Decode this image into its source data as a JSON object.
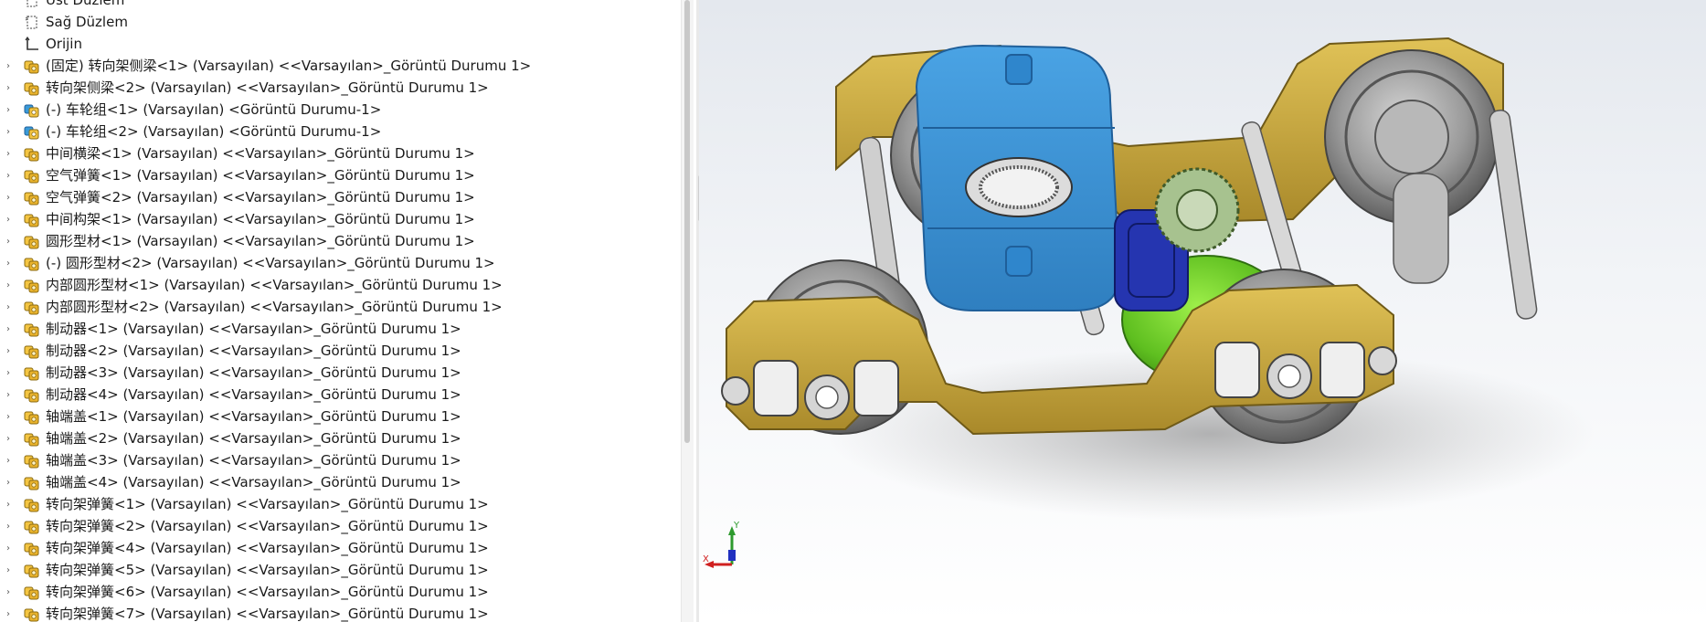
{
  "feature_tree": {
    "rows": [
      {
        "expander": "",
        "icon": "plane-icon",
        "label": "Üst Düzlem"
      },
      {
        "expander": "",
        "icon": "plane-icon",
        "label": "Sağ Düzlem"
      },
      {
        "expander": "",
        "icon": "origin-icon",
        "label": "Orijin"
      },
      {
        "expander": "›",
        "icon": "subassembly-icon",
        "label": "(固定) 转向架侧梁<1> (Varsayılan) <<Varsayılan>_Görüntü Durumu 1>"
      },
      {
        "expander": "›",
        "icon": "subassembly-icon",
        "label": "转向架侧梁<2> (Varsayılan) <<Varsayılan>_Görüntü Durumu 1>"
      },
      {
        "expander": "›",
        "icon": "assembly-icon",
        "label": "(-) 车轮组<1> (Varsayılan) <Görüntü Durumu-1>"
      },
      {
        "expander": "›",
        "icon": "assembly-icon",
        "label": "(-) 车轮组<2> (Varsayılan) <Görüntü Durumu-1>"
      },
      {
        "expander": "›",
        "icon": "subassembly-icon",
        "label": "中间横梁<1> (Varsayılan) <<Varsayılan>_Görüntü Durumu 1>"
      },
      {
        "expander": "›",
        "icon": "subassembly-icon",
        "label": "空气弹簧<1> (Varsayılan) <<Varsayılan>_Görüntü Durumu 1>"
      },
      {
        "expander": "›",
        "icon": "subassembly-icon",
        "label": "空气弹簧<2> (Varsayılan) <<Varsayılan>_Görüntü Durumu 1>"
      },
      {
        "expander": "›",
        "icon": "subassembly-icon",
        "label": "中间构架<1> (Varsayılan) <<Varsayılan>_Görüntü Durumu 1>"
      },
      {
        "expander": "›",
        "icon": "subassembly-icon",
        "label": "圆形型材<1> (Varsayılan) <<Varsayılan>_Görüntü Durumu 1>"
      },
      {
        "expander": "›",
        "icon": "subassembly-icon",
        "label": "(-) 圆形型材<2> (Varsayılan) <<Varsayılan>_Görüntü Durumu 1>"
      },
      {
        "expander": "›",
        "icon": "subassembly-icon",
        "label": "内部圆形型材<1> (Varsayılan) <<Varsayılan>_Görüntü Durumu 1>"
      },
      {
        "expander": "›",
        "icon": "subassembly-icon",
        "label": "内部圆形型材<2> (Varsayılan) <<Varsayılan>_Görüntü Durumu 1>"
      },
      {
        "expander": "›",
        "icon": "subassembly-icon",
        "label": "制动器<1> (Varsayılan) <<Varsayılan>_Görüntü Durumu 1>"
      },
      {
        "expander": "›",
        "icon": "subassembly-icon",
        "label": "制动器<2> (Varsayılan) <<Varsayılan>_Görüntü Durumu 1>"
      },
      {
        "expander": "›",
        "icon": "subassembly-icon",
        "label": "制动器<3> (Varsayılan) <<Varsayılan>_Görüntü Durumu 1>"
      },
      {
        "expander": "›",
        "icon": "subassembly-icon",
        "label": "制动器<4> (Varsayılan) <<Varsayılan>_Görüntü Durumu 1>"
      },
      {
        "expander": "›",
        "icon": "subassembly-icon",
        "label": "轴端盖<1> (Varsayılan) <<Varsayılan>_Görüntü Durumu 1>"
      },
      {
        "expander": "›",
        "icon": "subassembly-icon",
        "label": "轴端盖<2> (Varsayılan) <<Varsayılan>_Görüntü Durumu 1>"
      },
      {
        "expander": "›",
        "icon": "subassembly-icon",
        "label": "轴端盖<3> (Varsayılan) <<Varsayılan>_Görüntü Durumu 1>"
      },
      {
        "expander": "›",
        "icon": "subassembly-icon",
        "label": "轴端盖<4> (Varsayılan) <<Varsayılan>_Görüntü Durumu 1>"
      },
      {
        "expander": "›",
        "icon": "subassembly-icon",
        "label": "转向架弹簧<1> (Varsayılan) <<Varsayılan>_Görüntü Durumu 1>"
      },
      {
        "expander": "›",
        "icon": "subassembly-icon",
        "label": "转向架弹簧<2> (Varsayılan) <<Varsayılan>_Görüntü Durumu 1>"
      },
      {
        "expander": "›",
        "icon": "subassembly-icon",
        "label": "转向架弹簧<4> (Varsayılan) <<Varsayılan>_Görüntü Durumu 1>"
      },
      {
        "expander": "›",
        "icon": "subassembly-icon",
        "label": "转向架弹簧<5> (Varsayılan) <<Varsayılan>_Görüntü Durumu 1>"
      },
      {
        "expander": "›",
        "icon": "subassembly-icon",
        "label": "转向架弹簧<6> (Varsayılan) <<Varsayılan>_Görüntü Durumu 1>"
      },
      {
        "expander": "›",
        "icon": "subassembly-icon",
        "label": "转向架弹簧<7> (Varsayılan) <<Varsayılan>_Görüntü Durumu 1>"
      }
    ]
  },
  "viewport": {
    "triad": {
      "x_label": "X",
      "y_label": "Y"
    }
  },
  "colors": {
    "frame_gold": "#c9a93a",
    "bolster_blue": "#3a8fd1",
    "air_spring_green": "#6fcf2a",
    "motor_navy": "#1f2f9e",
    "wheel_grey": "#9a9a9a"
  }
}
